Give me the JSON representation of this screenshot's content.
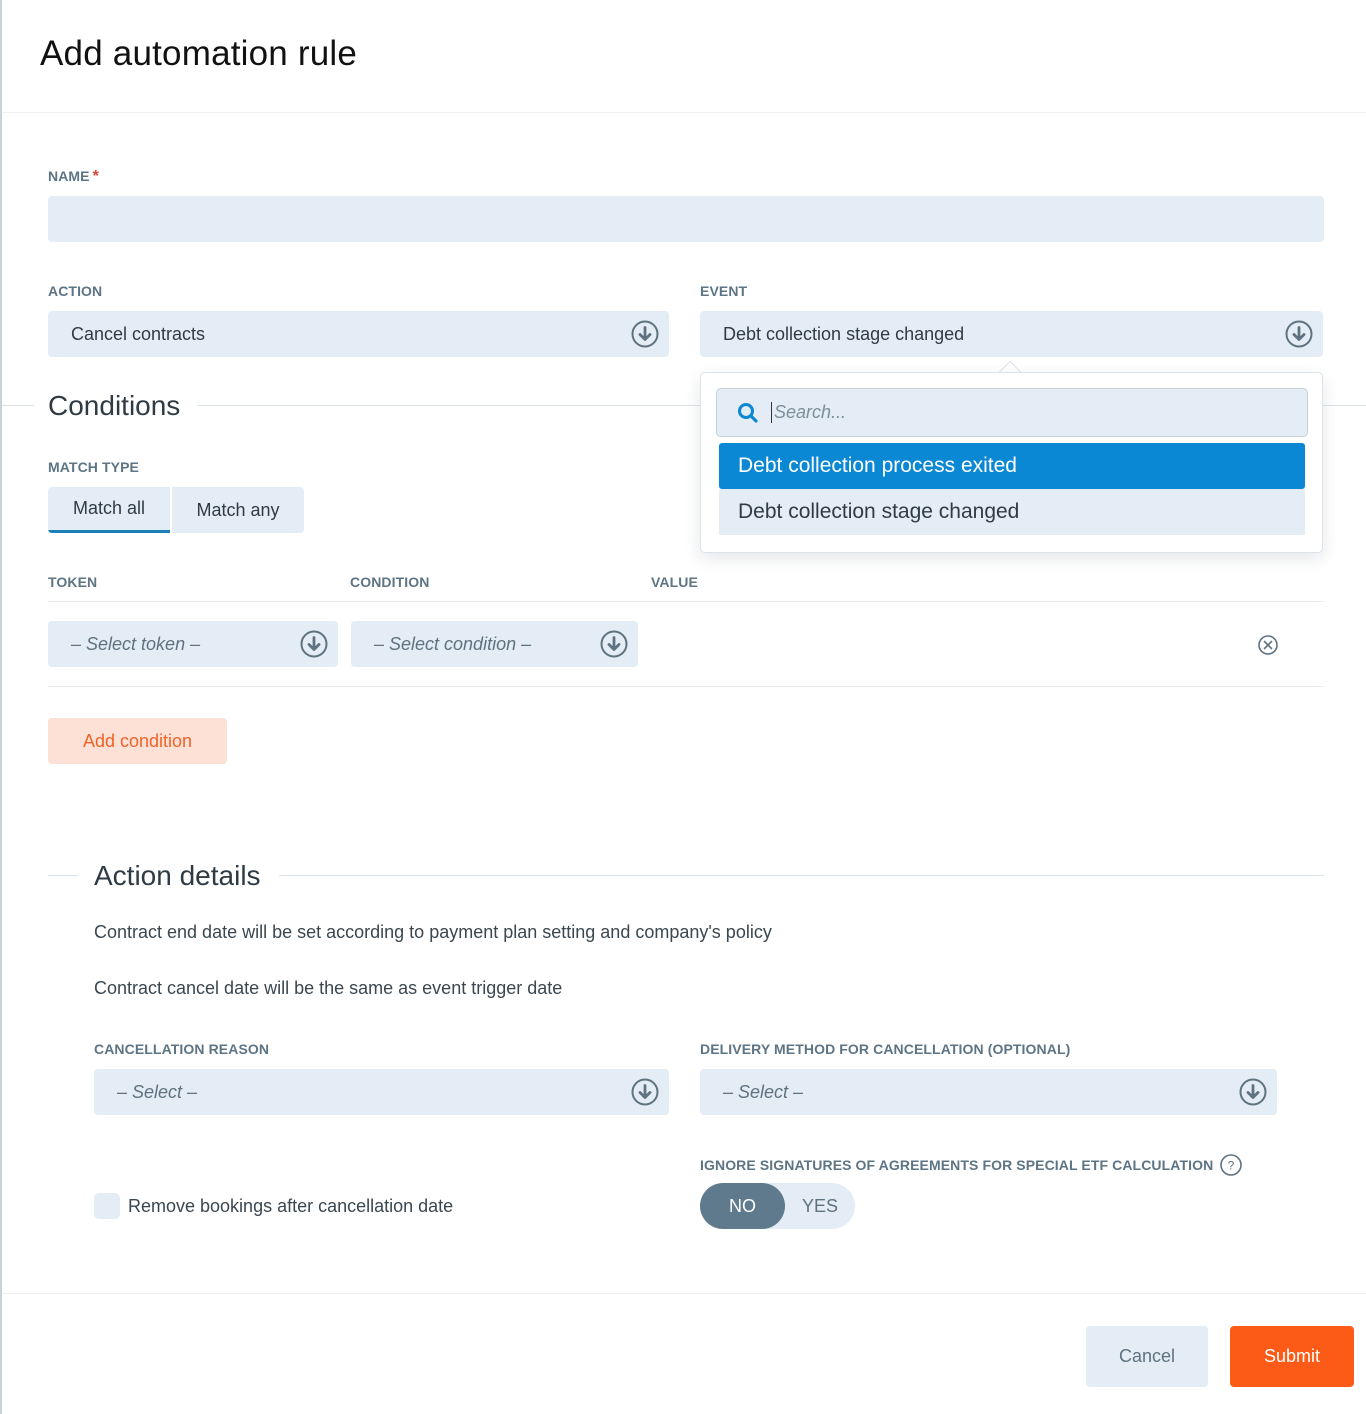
{
  "dialog": {
    "title": "Add automation rule"
  },
  "name_field": {
    "label": "NAME",
    "required_mark": "*",
    "value": "",
    "placeholder": ""
  },
  "action_field": {
    "label": "ACTION",
    "value": "Cancel contracts",
    "icon": "chevron-circle-down-icon"
  },
  "event_field": {
    "label": "EVENT",
    "value": "Debt collection stage changed",
    "icon": "chevron-circle-down-icon",
    "dropdown": {
      "open": true,
      "search_placeholder": "Search...",
      "search_value": "",
      "search_icon": "search-icon",
      "options": [
        {
          "label": "Debt collection process exited",
          "highlighted": true
        },
        {
          "label": "Debt collection stage changed",
          "highlighted": false
        }
      ]
    }
  },
  "conditions": {
    "title": "Conditions",
    "match_type": {
      "label": "MATCH TYPE",
      "options": [
        "Match all",
        "Match any"
      ],
      "selected": "Match all"
    },
    "table": {
      "headers": [
        "TOKEN",
        "CONDITION",
        "VALUE"
      ],
      "rows": [
        {
          "token_placeholder": "– Select token –",
          "condition_placeholder": "– Select condition –",
          "value": ""
        }
      ]
    },
    "add_button": "Add condition"
  },
  "action_details": {
    "title": "Action details",
    "descriptions": [
      "Contract end date will be set according to payment plan setting and company's policy",
      "Contract cancel date will be the same as event trigger date"
    ],
    "cancellation_reason": {
      "label": "CANCELLATION REASON",
      "placeholder": "– Select –"
    },
    "delivery_method": {
      "label": "DELIVERY METHOD FOR CANCELLATION (OPTIONAL)",
      "placeholder": "– Select –"
    },
    "remove_bookings": {
      "label": "Remove bookings after cancellation date",
      "checked": false
    },
    "ignore_signatures": {
      "label": "IGNORE SIGNATURES OF AGREEMENTS FOR SPECIAL ETF CALCULATION",
      "help_icon": "question-circle-icon",
      "options": [
        "NO",
        "YES"
      ],
      "selected": "NO"
    }
  },
  "footer": {
    "cancel_label": "Cancel",
    "submit_label": "Submit"
  },
  "colors": {
    "accent_orange": "#fc5a17",
    "highlight_blue": "#0a88d4",
    "field_bg": "#e4edf5",
    "toggle_on": "#5f7a8d",
    "required": "#e0403a"
  }
}
